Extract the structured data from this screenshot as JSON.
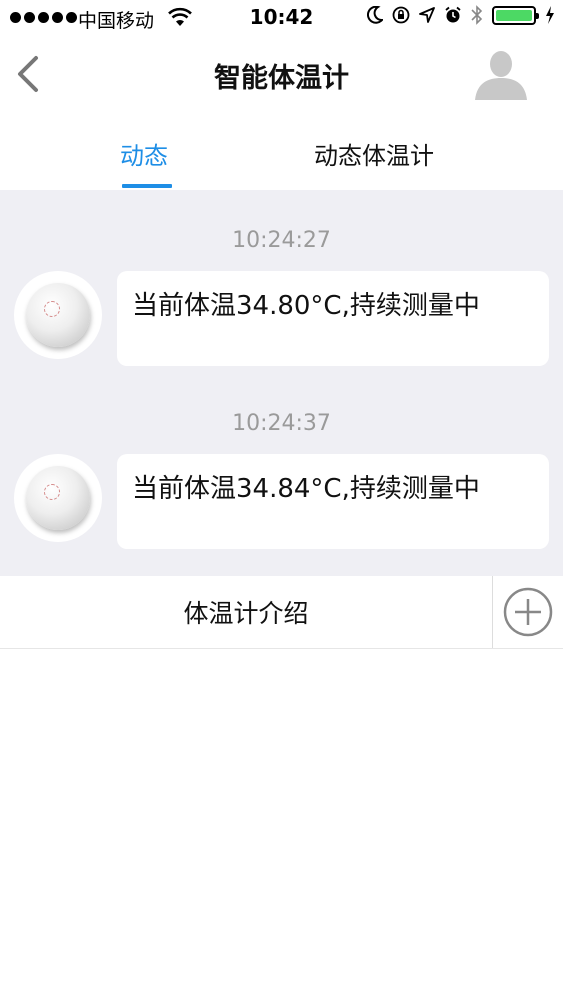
{
  "status_bar": {
    "carrier": "中国移动",
    "time": "10:42"
  },
  "nav": {
    "title": "智能体温计"
  },
  "tabs": [
    {
      "label": "动态",
      "active": true
    },
    {
      "label": "动态体温计",
      "active": false
    }
  ],
  "feed": {
    "items": [
      {
        "timestamp": "10:24:27",
        "message": "当前体温34.80°C,持续测量中"
      },
      {
        "timestamp": "10:24:37",
        "message": "当前体温34.84°C,持续测量中"
      }
    ]
  },
  "bottom_bar": {
    "intro_label": "体温计介绍"
  },
  "colors": {
    "accent": "#1e8ee6",
    "feed_background": "#efeff4",
    "battery": "#4cd964"
  },
  "icons": {
    "back": "chevron-left-icon",
    "avatar": "user-silhouette-icon",
    "add": "plus-circle-icon"
  }
}
